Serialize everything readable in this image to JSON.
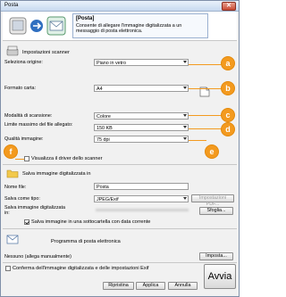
{
  "window": {
    "title": "Posta",
    "close_symbol": "✕"
  },
  "header": {
    "info_title": "[Posta]",
    "info_desc": "Consente di allegare l'immagine digitalizzata a un messaggio di posta elettronica."
  },
  "scanner": {
    "section_title": "Impostazioni scanner",
    "fields": [
      {
        "label": "Seleziona origine:",
        "value": "Piano in vetro"
      },
      {
        "label": "Formato carta:",
        "value": "A4"
      },
      {
        "label": "Modalità di scansione:",
        "value": "Colore"
      },
      {
        "label": "Limite massimo del file allegato:",
        "value": "150 KB"
      },
      {
        "label": "Qualità immagine:",
        "value": "75 dpi"
      }
    ],
    "show_driver_label": "Visualizza il driver dello scanner"
  },
  "save": {
    "section_title": "Salva immagine digitalizzata in",
    "filename_label": "Nome file:",
    "filename_value": "Posta",
    "type_label": "Salva come tipo:",
    "type_value": "JPEG/Exif",
    "pdf_settings_label": "Impostazioni PDF...",
    "location_label": "Salva immagine digitalizzata in:",
    "browse_label": "Sfoglia...",
    "subfolder_label": "Salva immagine in una sottocartella con data corrente"
  },
  "mail": {
    "section_title": "Programma di posta elettronica",
    "app_value": "Nessuno (allega manualmente)",
    "settings_label": "Imposta..."
  },
  "confirm_label": "Conferma dell'immagine digitalizzata e delle impostazioni Exif",
  "buttons": {
    "reset": "Ripristina",
    "apply": "Applica",
    "cancel": "Annulla",
    "run": "Avvia"
  },
  "callouts": [
    "a",
    "b",
    "c",
    "d",
    "e",
    "f"
  ],
  "colors": {
    "callout": "#f39a1f",
    "title_bar": "#c7d9ef",
    "close": "#c84a33"
  }
}
